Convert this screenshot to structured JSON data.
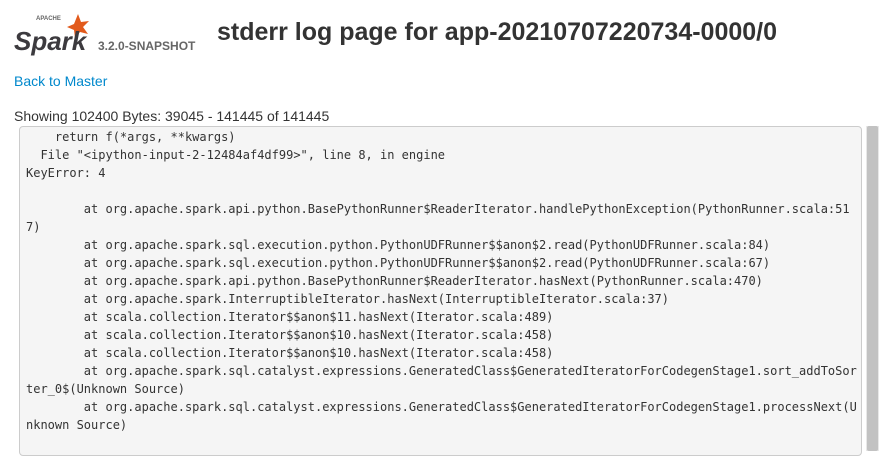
{
  "header": {
    "logo_small_text": "APACHE",
    "logo_text": "Spark",
    "version": "3.2.0-SNAPSHOT",
    "title": "stderr log page for app-20210707220734-0000/0",
    "brand_color": "#e25a1c"
  },
  "nav": {
    "back_link": "Back to Master",
    "link_color": "#0088cc"
  },
  "summary": {
    "showing": "Showing 102400 Bytes: 39045 - 141445 of 141445"
  },
  "log": {
    "text": "    return f(*args, **kwargs)\n  File \"<ipython-input-2-12484af4df99>\", line 8, in engine\nKeyError: 4\n\n\tat org.apache.spark.api.python.BasePythonRunner$ReaderIterator.handlePythonException(PythonRunner.scala:517)\n\tat org.apache.spark.sql.execution.python.PythonUDFRunner$$anon$2.read(PythonUDFRunner.scala:84)\n\tat org.apache.spark.sql.execution.python.PythonUDFRunner$$anon$2.read(PythonUDFRunner.scala:67)\n\tat org.apache.spark.api.python.BasePythonRunner$ReaderIterator.hasNext(PythonRunner.scala:470)\n\tat org.apache.spark.InterruptibleIterator.hasNext(InterruptibleIterator.scala:37)\n\tat scala.collection.Iterator$$anon$11.hasNext(Iterator.scala:489)\n\tat scala.collection.Iterator$$anon$10.hasNext(Iterator.scala:458)\n\tat scala.collection.Iterator$$anon$10.hasNext(Iterator.scala:458)\n\tat org.apache.spark.sql.catalyst.expressions.GeneratedClass$GeneratedIteratorForCodegenStage1.sort_addToSorter_0$(Unknown Source)\n\tat org.apache.spark.sql.catalyst.expressions.GeneratedClass$GeneratedIteratorForCodegenStage1.processNext(Unknown Source)"
  }
}
